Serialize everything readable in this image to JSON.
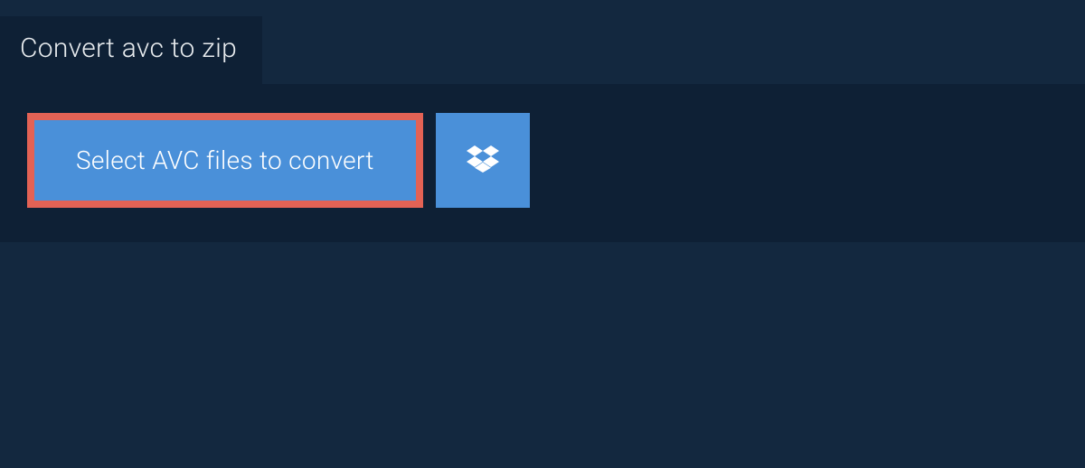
{
  "tab": {
    "label": "Convert avc to zip"
  },
  "actions": {
    "select_label": "Select AVC files to convert"
  }
}
